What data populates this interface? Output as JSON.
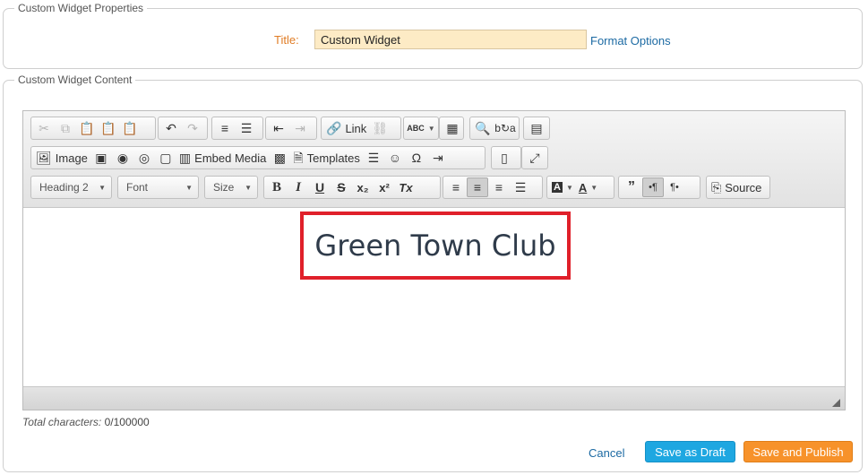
{
  "properties": {
    "legend": "Custom Widget Properties",
    "title_label": "Title:",
    "title_value": "Custom Widget",
    "format_options": "Format Options"
  },
  "content": {
    "legend": "Custom Widget Content",
    "toolbar": {
      "link": "Link",
      "image": "Image",
      "embed_media": "Embed Media",
      "templates": "Templates",
      "format": "Heading 2",
      "font": "Font",
      "size": "Size",
      "source": "Source",
      "bold": "B",
      "italic": "I",
      "underline": "U",
      "strike": "S",
      "subscript": "x₂",
      "superscript": "x²",
      "remove_format": "Tx",
      "omega": "Ω"
    },
    "body_text": "Green Town Club",
    "counter_label": "Total characters:",
    "counter_value": "0/100000"
  },
  "actions": {
    "cancel": "Cancel",
    "save_draft": "Save as Draft",
    "save_publish": "Save and Publish"
  },
  "colors": {
    "title_label": "#e07c25",
    "title_input_bg": "#fdebc5",
    "link": "#1c6aa3",
    "highlight_border": "#e0202a",
    "draft_button": "#1ea7e1",
    "publish_button": "#f7922a"
  }
}
